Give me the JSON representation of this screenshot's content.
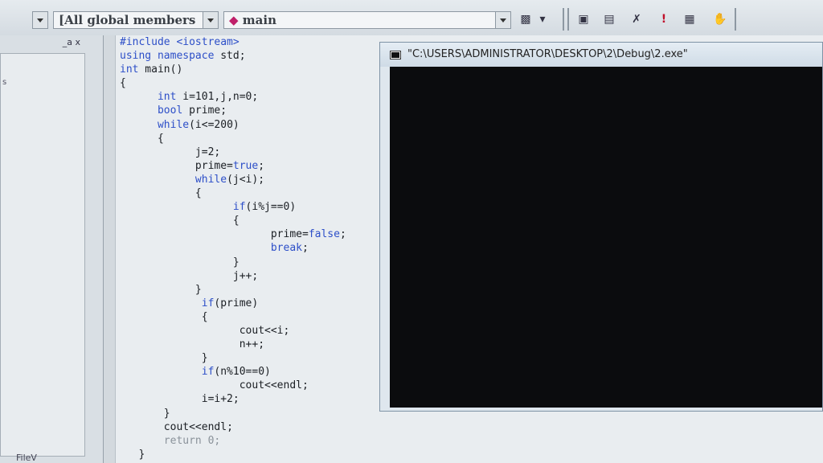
{
  "toolbar": {
    "scope_combo": "[All global members",
    "function_combo": "main",
    "function_icon": "diamond-icon",
    "buttons": [
      "class-wizard-icon",
      "compile-icon",
      "build-icon",
      "stop-build-icon",
      "execute-icon",
      "insert-breakpoint-icon",
      "go-icon"
    ]
  },
  "left_pane": {
    "close_buttons": "_a x",
    "letter": "s",
    "bottom_tab": "FileV"
  },
  "code": {
    "lines": [
      {
        "indent": "",
        "segments": [
          {
            "t": "#include <iostream>",
            "c": "kw"
          }
        ]
      },
      {
        "indent": "",
        "segments": [
          {
            "t": "using namespace",
            "c": "kw"
          },
          {
            "t": " std;",
            "c": ""
          }
        ]
      },
      {
        "indent": "",
        "segments": [
          {
            "t": "int",
            "c": "kw"
          },
          {
            "t": " main()",
            "c": ""
          }
        ]
      },
      {
        "indent": "",
        "segments": [
          {
            "t": "{",
            "c": ""
          }
        ]
      },
      {
        "indent": "      ",
        "segments": [
          {
            "t": "int",
            "c": "kw"
          },
          {
            "t": " i=101,j,n=0;",
            "c": ""
          }
        ]
      },
      {
        "indent": "      ",
        "segments": [
          {
            "t": "bool",
            "c": "kw"
          },
          {
            "t": " prime;",
            "c": ""
          }
        ]
      },
      {
        "indent": "      ",
        "segments": [
          {
            "t": "while",
            "c": "kw"
          },
          {
            "t": "(i<=200)",
            "c": ""
          }
        ]
      },
      {
        "indent": "      ",
        "segments": [
          {
            "t": "{",
            "c": ""
          }
        ]
      },
      {
        "indent": "            ",
        "segments": [
          {
            "t": "j=2;",
            "c": ""
          }
        ]
      },
      {
        "indent": "            ",
        "segments": [
          {
            "t": "prime=",
            "c": ""
          },
          {
            "t": "true",
            "c": "kw"
          },
          {
            "t": ";",
            "c": ""
          }
        ]
      },
      {
        "indent": "            ",
        "segments": [
          {
            "t": "while",
            "c": "kw"
          },
          {
            "t": "(j<i);",
            "c": ""
          }
        ]
      },
      {
        "indent": "            ",
        "segments": [
          {
            "t": "{",
            "c": ""
          }
        ]
      },
      {
        "indent": "                  ",
        "segments": [
          {
            "t": "if",
            "c": "kw"
          },
          {
            "t": "(i%j==0)",
            "c": ""
          }
        ]
      },
      {
        "indent": "                  ",
        "segments": [
          {
            "t": "{",
            "c": ""
          }
        ]
      },
      {
        "indent": "                        ",
        "segments": [
          {
            "t": "prime=",
            "c": ""
          },
          {
            "t": "false",
            "c": "kw"
          },
          {
            "t": ";",
            "c": ""
          }
        ]
      },
      {
        "indent": "                        ",
        "segments": [
          {
            "t": "break",
            "c": "kw"
          },
          {
            "t": ";",
            "c": ""
          }
        ]
      },
      {
        "indent": "                  ",
        "segments": [
          {
            "t": "}",
            "c": ""
          }
        ]
      },
      {
        "indent": "                  ",
        "segments": [
          {
            "t": "j++;",
            "c": ""
          }
        ]
      },
      {
        "indent": "            ",
        "segments": [
          {
            "t": "}",
            "c": ""
          }
        ]
      },
      {
        "indent": "             ",
        "segments": [
          {
            "t": "if",
            "c": "kw"
          },
          {
            "t": "(prime)",
            "c": ""
          }
        ]
      },
      {
        "indent": "             ",
        "segments": [
          {
            "t": "{",
            "c": ""
          }
        ]
      },
      {
        "indent": "                   ",
        "segments": [
          {
            "t": "cout<<i;",
            "c": ""
          }
        ]
      },
      {
        "indent": "                   ",
        "segments": [
          {
            "t": "n++;",
            "c": ""
          }
        ]
      },
      {
        "indent": "             ",
        "segments": [
          {
            "t": "}",
            "c": ""
          }
        ]
      },
      {
        "indent": "             ",
        "segments": [
          {
            "t": "if",
            "c": "kw"
          },
          {
            "t": "(n%10==0)",
            "c": ""
          }
        ]
      },
      {
        "indent": "                   ",
        "segments": [
          {
            "t": "cout<<endl;",
            "c": ""
          }
        ]
      },
      {
        "indent": "             ",
        "segments": [
          {
            "t": "i=i+2;",
            "c": ""
          }
        ]
      },
      {
        "indent": "       ",
        "segments": [
          {
            "t": "}",
            "c": ""
          }
        ]
      },
      {
        "indent": "       ",
        "segments": [
          {
            "t": "cout<<endl;",
            "c": ""
          }
        ]
      },
      {
        "indent": "       ",
        "segments": [
          {
            "t": "return 0;",
            "c": "cmt"
          }
        ]
      },
      {
        "indent": "   ",
        "segments": [
          {
            "t": "}",
            "c": ""
          }
        ]
      }
    ]
  },
  "console": {
    "title": "\"C:\\USERS\\ADMINISTRATOR\\DESKTOP\\2\\Debug\\2.exe\"",
    "icon": "console-window-icon"
  }
}
